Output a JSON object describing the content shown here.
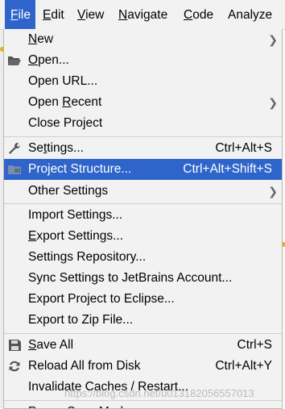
{
  "menubar": {
    "items": [
      {
        "label": "File",
        "mnemonic": "F",
        "rest": "ile"
      },
      {
        "label": "Edit",
        "mnemonic": "E",
        "rest": "dit"
      },
      {
        "label": "View",
        "mnemonic": "V",
        "rest": "iew"
      },
      {
        "label": "Navigate",
        "mnemonic": "N",
        "rest": "avigate"
      },
      {
        "label": "Code",
        "mnemonic": "C",
        "rest": "ode"
      },
      {
        "label": "Analyze",
        "mnemonic": "",
        "rest": "Analyze"
      }
    ]
  },
  "file_menu": {
    "items": [
      {
        "pre": "",
        "u": "N",
        "post": "ew",
        "shortcut": "",
        "submenu": true,
        "icon": ""
      },
      {
        "pre": "",
        "u": "O",
        "post": "pen...",
        "shortcut": "",
        "submenu": false,
        "icon": "folder-open-icon"
      },
      {
        "pre": "Open URL...",
        "u": "",
        "post": "",
        "shortcut": "",
        "submenu": false,
        "icon": ""
      },
      {
        "pre": "Open ",
        "u": "R",
        "post": "ecent",
        "shortcut": "",
        "submenu": true,
        "icon": ""
      },
      {
        "pre": "Close Project",
        "u": "",
        "post": "",
        "shortcut": "",
        "submenu": false,
        "icon": ""
      },
      {
        "pre": "Se",
        "u": "t",
        "post": "tings...",
        "shortcut": "Ctrl+Alt+S",
        "submenu": false,
        "icon": "wrench-icon"
      },
      {
        "pre": "Project Structure...",
        "u": "",
        "post": "",
        "shortcut": "Ctrl+Alt+Shift+S",
        "submenu": false,
        "icon": "project-structure-icon"
      },
      {
        "pre": "Other Settings",
        "u": "",
        "post": "",
        "shortcut": "",
        "submenu": true,
        "icon": ""
      },
      {
        "pre": "Import Settings...",
        "u": "",
        "post": "",
        "shortcut": "",
        "submenu": false,
        "icon": ""
      },
      {
        "pre": "",
        "u": "E",
        "post": "xport Settings...",
        "shortcut": "",
        "submenu": false,
        "icon": ""
      },
      {
        "pre": "Settings Repository...",
        "u": "",
        "post": "",
        "shortcut": "",
        "submenu": false,
        "icon": ""
      },
      {
        "pre": "Sync Settings to JetBrains Account...",
        "u": "",
        "post": "",
        "shortcut": "",
        "submenu": false,
        "icon": ""
      },
      {
        "pre": "Export Project to Eclipse...",
        "u": "",
        "post": "",
        "shortcut": "",
        "submenu": false,
        "icon": ""
      },
      {
        "pre": "Export to Zip File...",
        "u": "",
        "post": "",
        "shortcut": "",
        "submenu": false,
        "icon": ""
      },
      {
        "pre": "",
        "u": "S",
        "post": "ave All",
        "shortcut": "Ctrl+S",
        "submenu": false,
        "icon": "save-icon"
      },
      {
        "pre": "Reload All from Disk",
        "u": "",
        "post": "",
        "shortcut": "Ctrl+Alt+Y",
        "submenu": false,
        "icon": "reload-icon"
      },
      {
        "pre": "Invalidate Caches / Restart...",
        "u": "",
        "post": "",
        "shortcut": "",
        "submenu": false,
        "icon": ""
      },
      {
        "pre": "Power Save Mode",
        "u": "",
        "post": "",
        "shortcut": "",
        "submenu": false,
        "icon": ""
      }
    ]
  },
  "watermark": "https://blog.csdn.net/u013182056557013",
  "colors": {
    "accent": "#2f65ca",
    "menu_bg": "#f2f2f2"
  }
}
